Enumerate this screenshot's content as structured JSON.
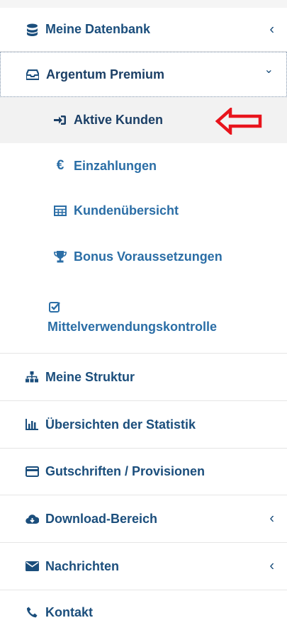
{
  "menu": {
    "items": [
      {
        "label": "Meine Datenbank",
        "icon": "database-icon",
        "caret": "‹"
      },
      {
        "label": "Argentum Premium",
        "icon": "inbox-icon",
        "caret": "⌄"
      },
      {
        "label": "Meine Struktur",
        "icon": "sitemap-icon"
      },
      {
        "label": "Übersichten der Statistik",
        "icon": "bar-chart-icon"
      },
      {
        "label": "Gutschriften / Provisionen",
        "icon": "credit-card-icon"
      },
      {
        "label": "Download-Bereich",
        "icon": "cloud-download-icon",
        "caret": "‹"
      },
      {
        "label": "Nachrichten",
        "icon": "envelope-icon",
        "caret": "‹"
      },
      {
        "label": "Kontakt",
        "icon": "phone-icon"
      }
    ],
    "submenu": [
      {
        "label": "Aktive Kunden",
        "icon": "sign-in-icon"
      },
      {
        "label": "Einzahlungen",
        "icon": "euro-icon"
      },
      {
        "label": "Kundenübersicht",
        "icon": "table-icon"
      },
      {
        "label": "Bonus Voraussetzungen",
        "icon": "trophy-icon"
      },
      {
        "label": "Mittelverwendungskontrolle",
        "icon": "check-square-icon"
      }
    ]
  },
  "colors": {
    "text": "#1b4e7c",
    "subtext": "#2b6ea6",
    "active_bg": "#f2f2f2",
    "annotation_arrow": "#e8141c"
  }
}
